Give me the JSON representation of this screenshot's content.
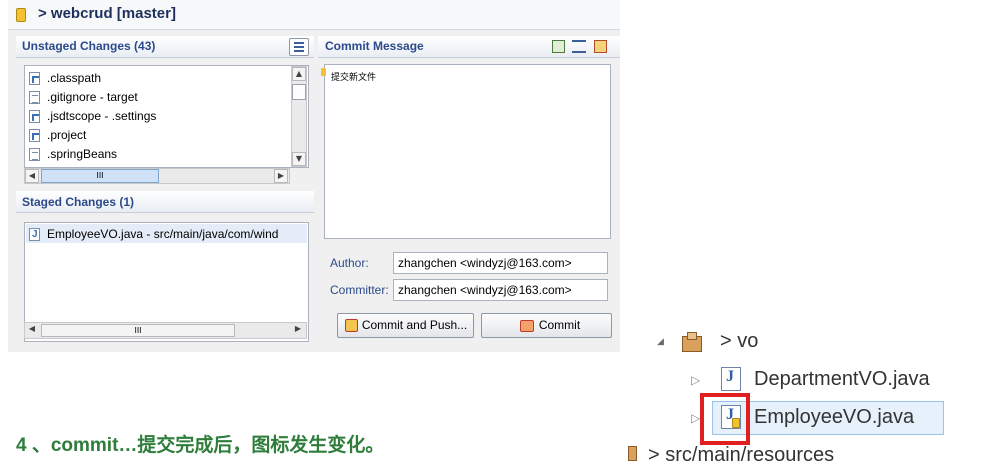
{
  "header": {
    "title": "> webcrud [master]"
  },
  "unstaged": {
    "title": "Unstaged Changes (43)",
    "files": [
      {
        "name": ".classpath",
        "icon": "xml-file-icon"
      },
      {
        "name": ".gitignore - target",
        "icon": "text-file-icon"
      },
      {
        "name": ".jsdtscope - .settings",
        "icon": "xml-file-icon"
      },
      {
        "name": ".project",
        "icon": "xml-file-icon"
      },
      {
        "name": ".springBeans",
        "icon": "text-file-icon"
      }
    ],
    "scroll_mark": "III"
  },
  "staged": {
    "title": "Staged Changes (1)",
    "files": [
      {
        "name": "EmployeeVO.java - src/main/java/com/wind",
        "icon": "java-file-icon"
      }
    ],
    "scroll_mark": "III"
  },
  "commit": {
    "title": "Commit Message",
    "message": "提交新文件",
    "author_label": "Author:",
    "author_value": "zhangchen <windyzj@163.com>",
    "committer_label": "Committer:",
    "committer_value": "zhangchen <windyzj@163.com>",
    "commit_push_label": "Commit and Push...",
    "commit_label": "Commit"
  },
  "caption": "4 、commit…提交完成后，图标发生变化。",
  "tree": {
    "package": "> vo",
    "items": [
      "DepartmentVO.java",
      "EmployeeVO.java"
    ],
    "resources": "> src/main/resources"
  },
  "colors": {
    "caption": "#2e7d3b",
    "highlight_box": "#e02020",
    "section_label": "#2c4a8a"
  }
}
